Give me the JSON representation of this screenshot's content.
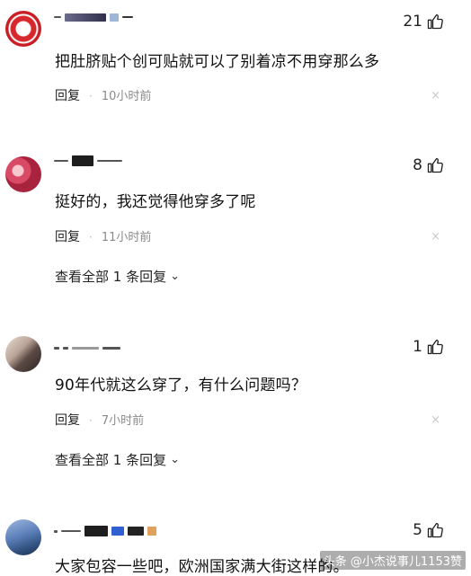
{
  "comments": [
    {
      "likes": "21",
      "text": "把肚脐贴个创可贴就可以了别着凉不用穿那么多",
      "reply_label": "回复",
      "time": "10小时前",
      "close_glyph": "×"
    },
    {
      "likes": "8",
      "text": "挺好的，我还觉得他穿多了呢",
      "reply_label": "回复",
      "time": "11小时前",
      "close_glyph": "×",
      "view_all": "查看全部 1 条回复"
    },
    {
      "likes": "1",
      "text": "90年代就这么穿了，有什么问题吗？",
      "reply_label": "回复",
      "time": "7小时前",
      "close_glyph": "×",
      "view_all": "查看全部 1 条回复"
    },
    {
      "likes": "5",
      "text": "大家包容一些吧，欧洲国家满大街这样的。"
    }
  ],
  "watermark": "头条 @小杰说事儿1153赞",
  "icons": {
    "like": "thumbs-up-icon",
    "chevron": "chevron-down-icon",
    "close": "close-icon"
  },
  "colors": {
    "text": "#111111",
    "muted": "#8a8a8a",
    "close": "#c8c8c8"
  }
}
